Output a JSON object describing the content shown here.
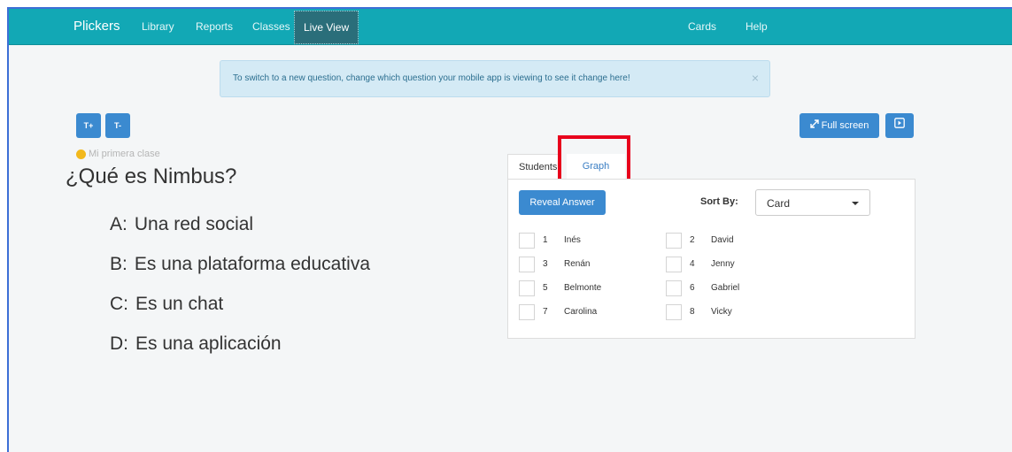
{
  "navbar": {
    "brand": "Plickers",
    "items": [
      "Library",
      "Reports",
      "Classes",
      "Live View"
    ],
    "right_items": [
      "Cards",
      "Help"
    ],
    "bg_color": "#12a8b5"
  },
  "alert": {
    "text": "To switch to a new question, change which question your mobile app is viewing to see it change here!",
    "close": "×"
  },
  "toolbar": {
    "increase_text": "T+",
    "decrease_text": "T-",
    "fullscreen_label": "Full screen",
    "fullscreen_icon": "expand-icon",
    "present_icon": "present-icon"
  },
  "question": {
    "class_name": "Mi primera clase",
    "class_color": "#f2b81c",
    "text": "¿Qué es Nimbus?",
    "answers": [
      {
        "letter": "A:",
        "text": "Una red social"
      },
      {
        "letter": "B:",
        "text": "Es una plataforma educativa"
      },
      {
        "letter": "C:",
        "text": "Es un chat"
      },
      {
        "letter": "D:",
        "text": "Es una aplicación"
      }
    ]
  },
  "results": {
    "tabs": [
      "Students",
      "Graph"
    ],
    "active_tab": "Students",
    "reveal_label": "Reveal Answer",
    "sort_label": "Sort By:",
    "sort_value": "Card",
    "students": [
      {
        "card": "1",
        "name": "Inés"
      },
      {
        "card": "2",
        "name": "David"
      },
      {
        "card": "3",
        "name": "Renán"
      },
      {
        "card": "4",
        "name": "Jenny"
      },
      {
        "card": "5",
        "name": "Belmonte"
      },
      {
        "card": "6",
        "name": "Gabriel"
      },
      {
        "card": "7",
        "name": "Carolina"
      },
      {
        "card": "8",
        "name": "Vicky"
      }
    ],
    "highlight_color": "#e8001c"
  }
}
